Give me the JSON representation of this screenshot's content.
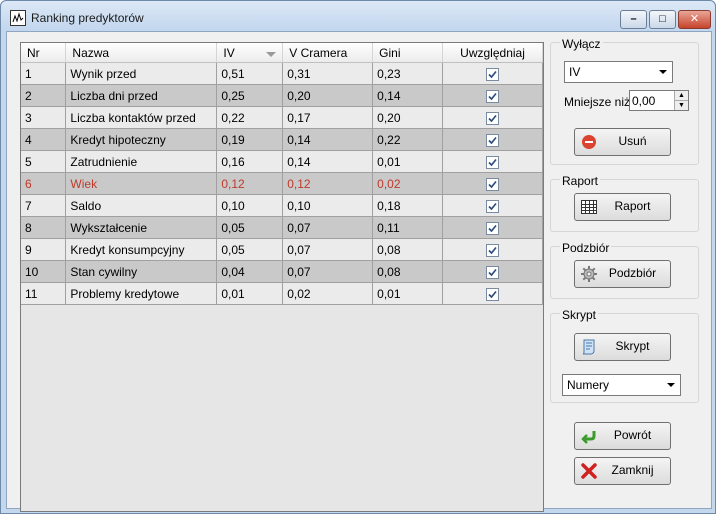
{
  "window": {
    "title": "Ranking predyktorów"
  },
  "table": {
    "headers": [
      "Nr",
      "Nazwa",
      "IV",
      "V Cramera",
      "Gini",
      "Uwzględniaj"
    ],
    "rows": [
      {
        "nr": "1",
        "nazwa": "Wynik przed",
        "iv": "0,51",
        "v": "0,31",
        "gini": "0,23",
        "checked": true
      },
      {
        "nr": "2",
        "nazwa": "Liczba dni przed",
        "iv": "0,25",
        "v": "0,20",
        "gini": "0,14",
        "checked": true
      },
      {
        "nr": "3",
        "nazwa": "Liczba kontaktów przed",
        "iv": "0,22",
        "v": "0,17",
        "gini": "0,20",
        "checked": true
      },
      {
        "nr": "4",
        "nazwa": "Kredyt hipoteczny",
        "iv": "0,19",
        "v": "0,14",
        "gini": "0,22",
        "checked": true
      },
      {
        "nr": "5",
        "nazwa": "Zatrudnienie",
        "iv": "0,16",
        "v": "0,14",
        "gini": "0,01",
        "checked": true
      },
      {
        "nr": "6",
        "nazwa": "Wiek",
        "iv": "0,12",
        "v": "0,12",
        "gini": "0,02",
        "checked": true,
        "highlight": "#c0392b"
      },
      {
        "nr": "7",
        "nazwa": "Saldo",
        "iv": "0,10",
        "v": "0,10",
        "gini": "0,18",
        "checked": true
      },
      {
        "nr": "8",
        "nazwa": "Wykształcenie",
        "iv": "0,05",
        "v": "0,07",
        "gini": "0,11",
        "checked": true
      },
      {
        "nr": "9",
        "nazwa": "Kredyt konsumpcyjny",
        "iv": "0,05",
        "v": "0,07",
        "gini": "0,08",
        "checked": true
      },
      {
        "nr": "10",
        "nazwa": "Stan cywilny",
        "iv": "0,04",
        "v": "0,07",
        "gini": "0,08",
        "checked": true
      },
      {
        "nr": "11",
        "nazwa": "Problemy kredytowe",
        "iv": "0,01",
        "v": "0,02",
        "gini": "0,01",
        "checked": true
      }
    ]
  },
  "sidebar": {
    "wylacz": {
      "label": "Wyłącz",
      "select_value": "IV",
      "threshold_label": "Mniejsze niż:",
      "threshold_value": "0,00",
      "remove_label": "Usuń"
    },
    "raport": {
      "label": "Raport",
      "button_label": "Raport"
    },
    "podzbior": {
      "label": "Podzbiór",
      "button_label": "Podzbiór"
    },
    "skrypt": {
      "label": "Skrypt",
      "button_label": "Skrypt",
      "select_value": "Numery"
    },
    "back_label": "Powrót",
    "close_label": "Zamknij"
  }
}
